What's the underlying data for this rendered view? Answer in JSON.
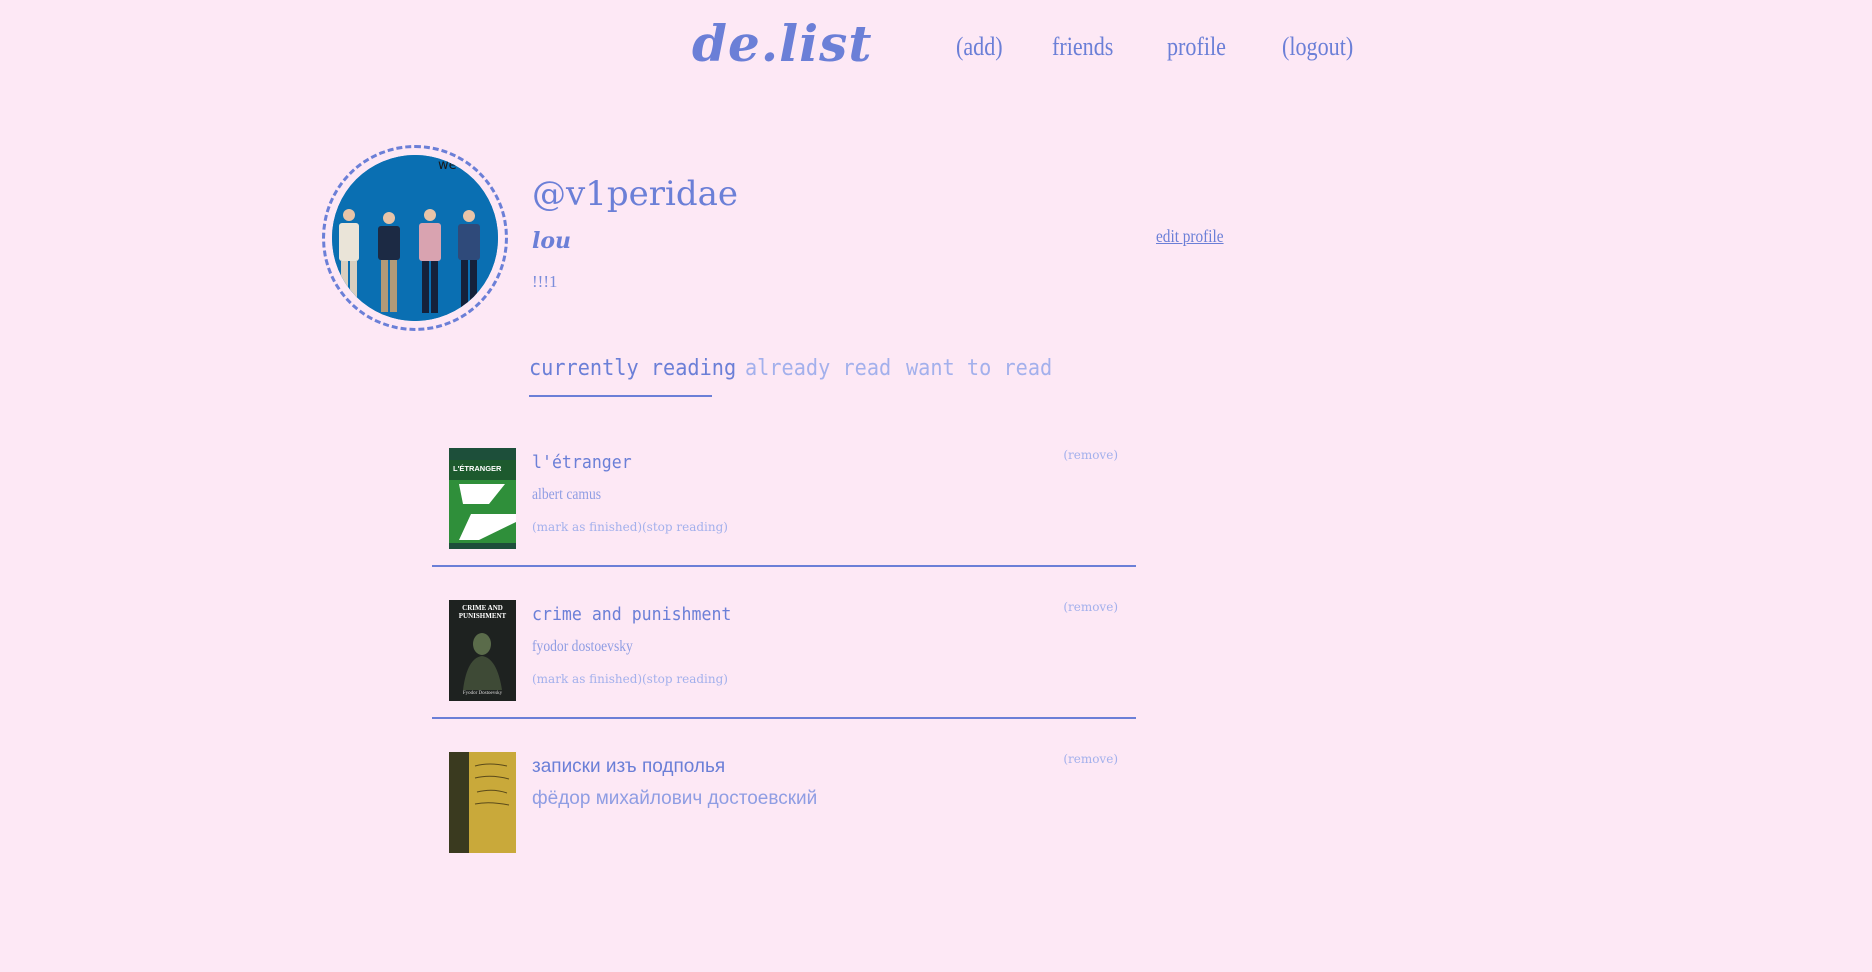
{
  "nav": {
    "logo": "de.list",
    "add": "(add)",
    "friends": "friends",
    "profile": "profile",
    "logout": "(logout)"
  },
  "profile": {
    "username": "@v1peridae",
    "display_name": "lou",
    "bio": "!!!1",
    "edit_label": "edit profile",
    "avatar_album_text": "we"
  },
  "tabs": [
    {
      "label": "currently reading",
      "active": true
    },
    {
      "label": "already read",
      "active": false
    },
    {
      "label": "want to read",
      "active": false
    }
  ],
  "books": [
    {
      "title": "l'étranger",
      "author": "albert camus",
      "cover_title": "L'ÉTRANGER",
      "mark_finished": "(mark as finished)",
      "stop_reading": "(stop reading)",
      "remove": "(remove)"
    },
    {
      "title": "crime and punishment",
      "author": "fyodor dostoevsky",
      "cover_title": "CRIME AND PUNISHMENT",
      "cover_author": "Fyodor Dostoevsky",
      "mark_finished": "(mark as finished)",
      "stop_reading": "(stop reading)",
      "remove": "(remove)"
    },
    {
      "title": "записки изъ подполья",
      "author": "фёдор михайлович достоевский",
      "remove": "(remove)"
    }
  ],
  "colors": {
    "background": "#fde8f5",
    "accent": "#6b7fd7",
    "muted": "#a3b0ec"
  }
}
